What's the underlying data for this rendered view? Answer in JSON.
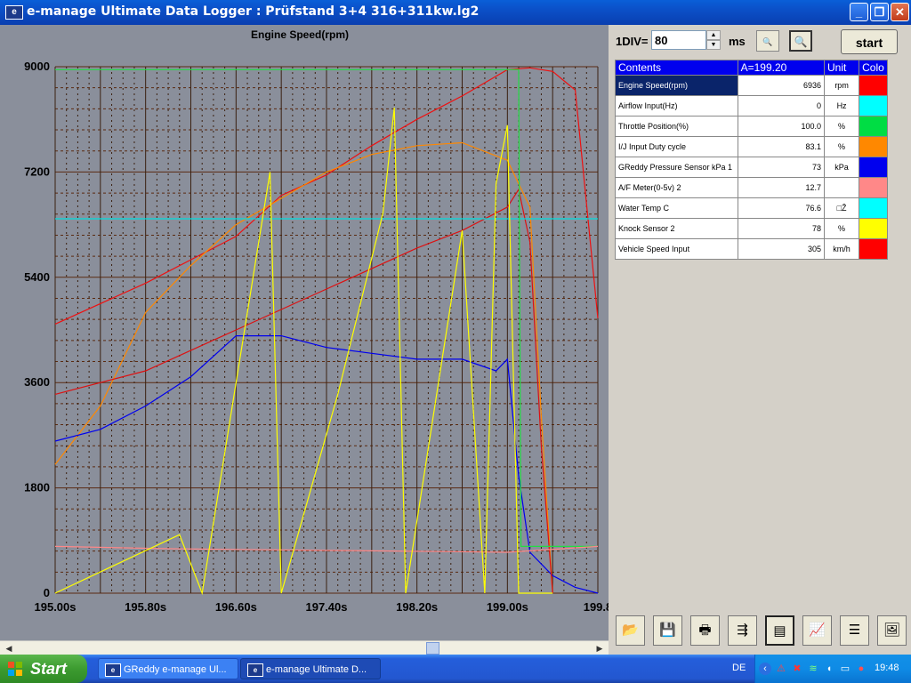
{
  "window": {
    "title": "e-manage Ultimate Data Logger : Prüfstand 3+4 316+311kw.lg2",
    "icon_text": "e"
  },
  "controls": {
    "div_label": "1DIV=",
    "div_value": "80",
    "ms_label": "ms",
    "start_label": "start"
  },
  "table": {
    "headers": {
      "contents": "Contents",
      "cursor": "A=199.20",
      "unit": "Unit",
      "color": "Colo"
    },
    "rows": [
      {
        "name": "Engine Speed(rpm)",
        "value": "6936",
        "unit": "rpm",
        "color": "#ff0000"
      },
      {
        "name": "Airflow Input(Hz)",
        "value": "0",
        "unit": "Hz",
        "color": "#00ffff"
      },
      {
        "name": "Throttle Position(%)",
        "value": "100.0",
        "unit": "%",
        "color": "#00dd44"
      },
      {
        "name": "I/J Input Duty cycle",
        "value": "83.1",
        "unit": "%",
        "color": "#ff8800"
      },
      {
        "name": "GReddy Pressure Sensor kPa 1",
        "value": "73",
        "unit": "kPa",
        "color": "#0000ee"
      },
      {
        "name": "A/F Meter(0-5v) 2",
        "value": "12.7",
        "unit": "",
        "color": "#ff8888"
      },
      {
        "name": "Water Temp C",
        "value": "76.6",
        "unit": "□Ž",
        "color": "#00ffff"
      },
      {
        "name": "Knock Sensor 2",
        "value": "78",
        "unit": "%",
        "color": "#ffff00"
      },
      {
        "name": "Vehicle Speed Input",
        "value": "305",
        "unit": "km/h",
        "color": "#ff0000"
      }
    ]
  },
  "toolbar_icons": [
    "open-folder-icon",
    "save-icon",
    "print-icon",
    "export-icon",
    "graph-view-icon",
    "ab-compare-icon",
    "list-icon",
    "image-icon"
  ],
  "chart_data": {
    "type": "line",
    "title": "Engine Speed(rpm)",
    "y_ticks": [
      "9000",
      "7200",
      "5400",
      "3600",
      "1800",
      "0"
    ],
    "ylim": [
      0,
      9000
    ],
    "x_ticks": [
      "195.00s",
      "195.80s",
      "196.60s",
      "197.40s",
      "198.20s",
      "199.00s",
      "199.8"
    ],
    "xlim": [
      195.0,
      199.8
    ],
    "grid": true,
    "series": [
      {
        "name": "Engine Speed(rpm)",
        "color": "#ee1111",
        "x": [
          195.0,
          195.8,
          196.6,
          197.0,
          197.4,
          197.8,
          198.2,
          198.6,
          199.0,
          199.2,
          199.4,
          199.6,
          199.8
        ],
        "y": [
          4600,
          5300,
          6100,
          6800,
          7150,
          7650,
          8100,
          8500,
          8950,
          8980,
          8920,
          8600,
          4700
        ]
      },
      {
        "name": "I/J Input Duty cycle",
        "color": "#ff8800",
        "x": [
          195.0,
          195.4,
          195.8,
          196.2,
          196.6,
          197.0,
          197.4,
          197.8,
          198.2,
          198.6,
          199.0,
          199.1,
          199.2,
          199.3,
          199.4
        ],
        "y": [
          2200,
          3200,
          4800,
          5600,
          6300,
          6750,
          7200,
          7500,
          7650,
          7700,
          7400,
          7000,
          6600,
          3000,
          0
        ]
      },
      {
        "name": "GReddy Pressure Sensor kPa 1",
        "color": "#0000ee",
        "x": [
          195.0,
          195.4,
          195.8,
          196.2,
          196.6,
          197.0,
          197.4,
          197.8,
          198.2,
          198.6,
          198.9,
          199.0,
          199.1,
          199.2,
          199.4,
          199.6,
          199.8
        ],
        "y": [
          2600,
          2800,
          3200,
          3700,
          4400,
          4400,
          4200,
          4100,
          4000,
          4000,
          3800,
          4000,
          2000,
          700,
          300,
          100,
          0
        ]
      },
      {
        "name": "Vehicle Speed Input",
        "color": "#dd1111",
        "x": [
          195.0,
          195.8,
          196.6,
          197.4,
          198.2,
          198.6,
          199.0,
          199.1,
          199.2,
          199.3,
          199.4
        ],
        "y": [
          3400,
          3800,
          4500,
          5200,
          5900,
          6200,
          6600,
          6900,
          6000,
          2500,
          0
        ]
      },
      {
        "name": "Airflow Input(Hz)",
        "color": "#00dddd",
        "x": [
          195.0,
          199.8
        ],
        "y": [
          6400,
          6400
        ]
      },
      {
        "name": "Throttle Position(%)",
        "color": "#22dd44",
        "x": [
          195.0,
          199.1,
          199.12,
          199.2,
          199.8
        ],
        "y": [
          8950,
          8950,
          800,
          800,
          800
        ]
      },
      {
        "name": "A/F Meter(0-5v) 2",
        "color": "#ff8888",
        "x": [
          195.0,
          196.0,
          197.0,
          198.0,
          199.0,
          199.8
        ],
        "y": [
          800,
          760,
          740,
          720,
          700,
          800
        ]
      },
      {
        "name": "Knock Sensor 2",
        "color": "#ffff00",
        "x": [
          195.0,
          196.1,
          196.3,
          196.9,
          197.0,
          197.5,
          197.9,
          198.0,
          198.1,
          198.6,
          198.8,
          198.9,
          199.0,
          199.1,
          199.4
        ],
        "y": [
          0,
          1000,
          0,
          7200,
          0,
          3400,
          6500,
          8300,
          0,
          6200,
          0,
          7000,
          8000,
          0,
          0
        ]
      }
    ]
  },
  "taskbar": {
    "start_label": "Start",
    "tasks": [
      {
        "label": "GReddy e-manage Ul...",
        "active": false
      },
      {
        "label": "e-manage Ultimate D...",
        "active": true
      }
    ],
    "language": "DE",
    "clock": "19:48"
  }
}
